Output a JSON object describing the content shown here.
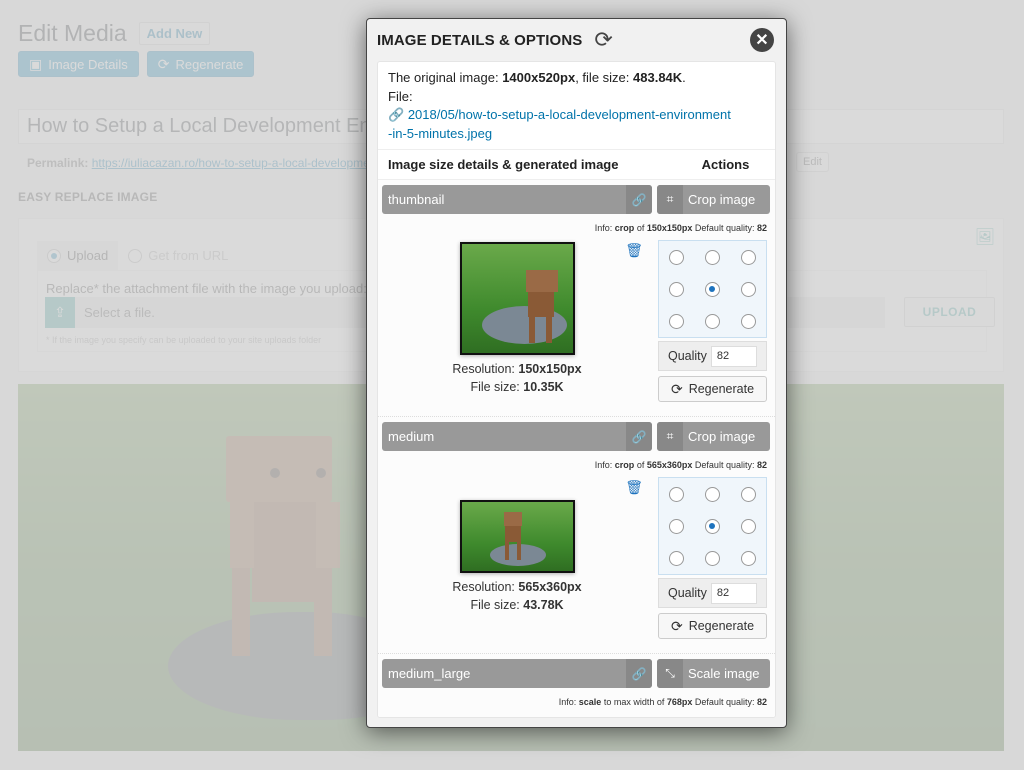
{
  "page": {
    "title": "Edit Media",
    "add_new": "Add New",
    "buttons": [
      {
        "label": "Image Details",
        "icon": "image-icon"
      },
      {
        "label": "Regenerate",
        "icon": "refresh-icon"
      }
    ],
    "post_title": "How to Setup a Local Development Environment in 5 Minutes",
    "permalink_label": "Permalink:",
    "permalink_url": "https://iuliacazan.ro/how-to-setup-a-local-development-environment-in-5-minutes/",
    "edit_label": "Edit",
    "section_label": "EASY REPLACE IMAGE",
    "replace": {
      "tabs": [
        {
          "label": "Upload",
          "selected": true
        },
        {
          "label": "Get from URL",
          "selected": false
        }
      ],
      "instruction": "Replace* the attachment file with the image you upload:",
      "file_placeholder": "Select a file.",
      "upload_button": "UPLOAD",
      "footnote": "* If the image you specify can be uploaded to your site uploads folder"
    }
  },
  "modal": {
    "title": "IMAGE DETAILS & OPTIONS",
    "original_label": "The original image:",
    "original_resolution": "1400x520px",
    "filesize_label": ", file size:",
    "original_filesize": "483.84K",
    "file_label": "File:",
    "file_path": "2018/05/how-to-setup-a-local-development-environment-in-5-minutes.jpeg",
    "file_path_line1": "2018/05/how-to-setup-a-local-development-environment",
    "file_path_line2": "-in-5-minutes.jpeg",
    "col_left": "Image size details & generated image",
    "col_right": "Actions",
    "sizes": [
      {
        "name": "thumbnail",
        "action": "Crop image",
        "action_icon": "crop-icon",
        "info_prefix": "Info:",
        "info_mode": "crop",
        "info_text": "of",
        "info_dim": "150x150px",
        "quality_label": "Default quality:",
        "default_quality": "82",
        "resolution_label": "Resolution:",
        "resolution": "150x150px",
        "filesize_label": "File size:",
        "filesize": "10.35K",
        "crop_position": "center",
        "quality_field_label": "Quality",
        "quality_value": "82",
        "regenerate_label": "Regenerate"
      },
      {
        "name": "medium",
        "action": "Crop image",
        "action_icon": "crop-icon",
        "info_prefix": "Info:",
        "info_mode": "crop",
        "info_text": "of",
        "info_dim": "565x360px",
        "quality_label": "Default quality:",
        "default_quality": "82",
        "resolution_label": "Resolution:",
        "resolution": "565x360px",
        "filesize_label": "File size:",
        "filesize": "43.78K",
        "crop_position": "center",
        "quality_field_label": "Quality",
        "quality_value": "82",
        "regenerate_label": "Regenerate"
      },
      {
        "name": "medium_large",
        "action": "Scale image",
        "action_icon": "scale-icon",
        "info_prefix": "Info:",
        "info_mode": "scale",
        "info_text": "to max width of",
        "info_dim": "768px",
        "quality_label": "Default quality:",
        "default_quality": "82"
      }
    ]
  },
  "colors": {
    "wp_blue": "#0085ba",
    "link_blue": "#0073aa",
    "teal": "#3aa39c",
    "size_bar_gray": "#999999",
    "trash_blue": "#1e73be"
  }
}
